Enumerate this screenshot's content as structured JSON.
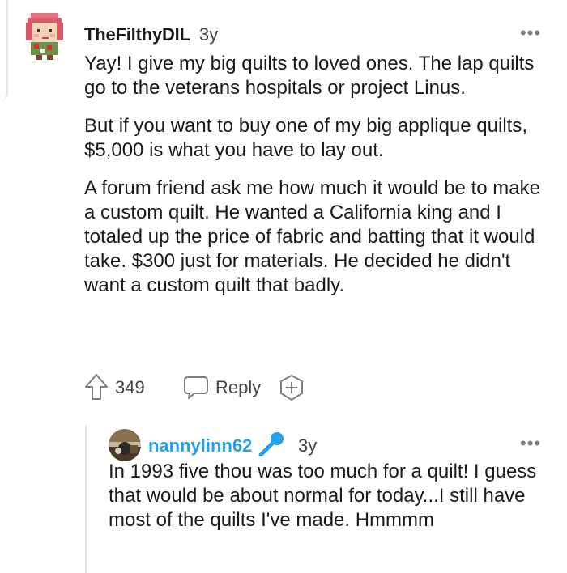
{
  "comment": {
    "author": "TheFilthyDIL",
    "age": "3y",
    "more_label": "•••",
    "avatar_icon": "pixel-avatar-pink-hair",
    "paragraphs": [
      "Yay! I give my big quilts to loved ones. The lap quilts go to the veterans hospitals or project Linus.",
      "But if you want to buy one of my big applique quilts, $5,000 is what you have to lay out.",
      "A forum friend ask me how much it would be to make a custom quilt. He wanted a California king and I totaled up the price of fabric and batting that it would take. $300 just for materials. He decided he didn't want a custom quilt that badly."
    ],
    "score": "349",
    "reply_label": "Reply",
    "icons": {
      "upvote": "upvote-arrow-icon",
      "reply": "speech-bubble-icon",
      "award": "award-plus-icon"
    }
  },
  "reply": {
    "author": "nannylinn62",
    "author_color": "#24a0ed",
    "flair_icon": "microphone-icon",
    "age": "3y",
    "more_label": "•••",
    "avatar_icon": "photo-avatar",
    "paragraphs": [
      "In 1993 five thou was too much for a quilt! I guess that would be about normal for today...I still have most of the quilts I've made. Hmmmm"
    ]
  },
  "colors": {
    "text": "#1a1a1b",
    "meta": "#444444",
    "link": "#24a0ed",
    "thread_line": "#e4e6e8"
  }
}
